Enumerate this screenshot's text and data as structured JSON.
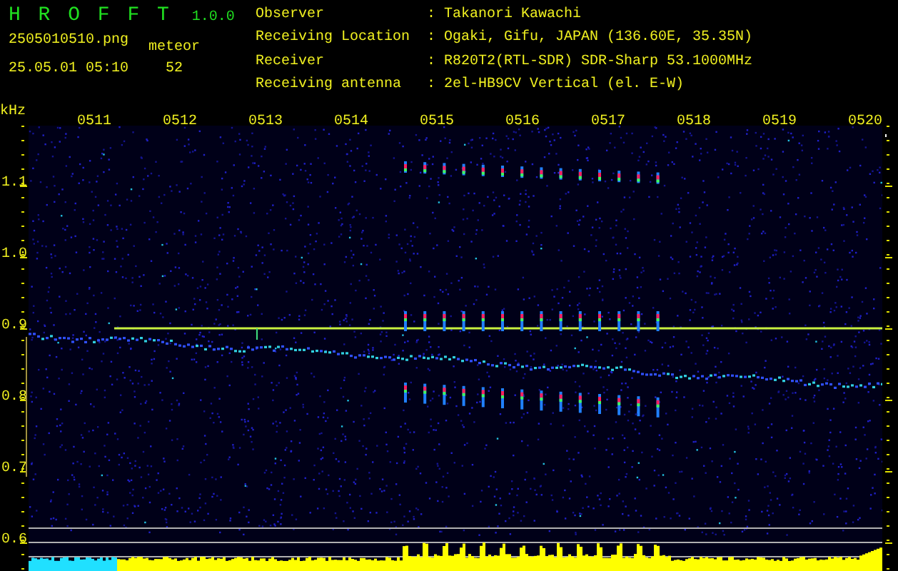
{
  "app": {
    "name": "H R O F F T",
    "version": "1.0.0"
  },
  "file": {
    "filename": "2505010510.png",
    "timestamp": "25.05.01 05:10"
  },
  "count": {
    "label": "meteor",
    "value": "52"
  },
  "info": [
    {
      "label": "Observer",
      "value": ": Takanori Kawachi"
    },
    {
      "label": "Receiving Location",
      "value": ": Ogaki, Gifu, JAPAN (136.60E, 35.35N)"
    },
    {
      "label": "Receiver",
      "value": ": R820T2(RTL-SDR) SDR-Sharp 53.1000MHz"
    },
    {
      "label": "Receiving antenna",
      "value": ": 2el-HB9CV Vertical (el. E-W)"
    }
  ],
  "spectrogram": {
    "y_unit": "kHz",
    "x_labels": [
      "0511",
      "0512",
      "0513",
      "0514",
      "0515",
      "0516",
      "0517",
      "0518",
      "0519",
      "0520"
    ],
    "y_labels": [
      "1.1",
      "1.0",
      "0.9",
      "0.8",
      "0.7",
      "0.6"
    ]
  }
}
